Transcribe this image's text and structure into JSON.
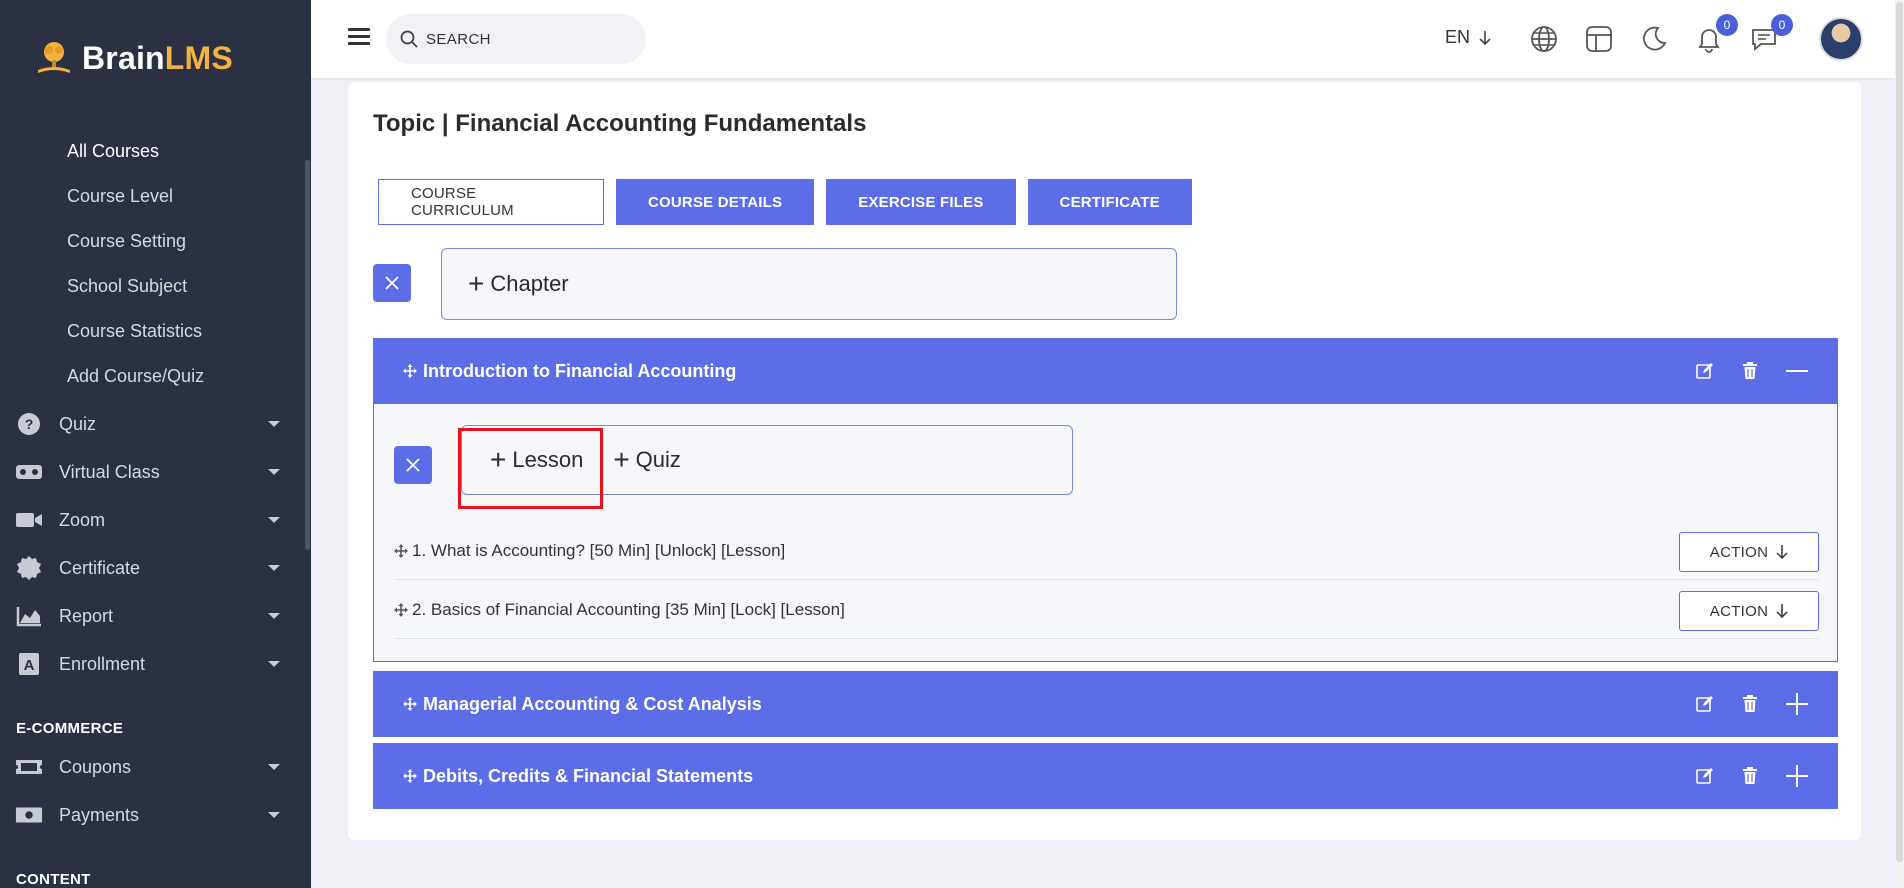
{
  "brand": {
    "name_white": "Brain",
    "name_yellow": "LMS"
  },
  "sidebar": {
    "sub_items": [
      {
        "label": "All Courses",
        "active": true
      },
      {
        "label": "Course Level"
      },
      {
        "label": "Course Setting"
      },
      {
        "label": "School Subject"
      },
      {
        "label": "Course Statistics"
      },
      {
        "label": "Add Course/Quiz"
      }
    ],
    "menu": [
      {
        "label": "Quiz",
        "icon": "question-circle-icon"
      },
      {
        "label": "Virtual Class",
        "icon": "vr-headset-icon"
      },
      {
        "label": "Zoom",
        "icon": "video-camera-icon"
      },
      {
        "label": "Certificate",
        "icon": "certificate-badge-icon"
      },
      {
        "label": "Report",
        "icon": "area-chart-icon"
      },
      {
        "label": "Enrollment",
        "icon": "enrollment-icon"
      }
    ],
    "section_ecommerce": "E-COMMERCE",
    "ecommerce_menu": [
      {
        "label": "Coupons",
        "icon": "ticket-icon"
      },
      {
        "label": "Payments",
        "icon": "money-bill-icon"
      }
    ],
    "section_content": "CONTENT"
  },
  "topbar": {
    "search_placeholder": "SEARCH",
    "lang": "EN",
    "notifications_count": "0",
    "messages_count": "0"
  },
  "main": {
    "title": "Topic | Financial Accounting Fundamentals",
    "tabs": [
      "COURSE CURRICULUM",
      "COURSE DETAILS",
      "EXERCISE FILES",
      "CERTIFICATE"
    ],
    "add_chapter": "Chapter",
    "add_lesson": "Lesson",
    "add_quiz": "Quiz",
    "chapters": [
      {
        "title": "Introduction to Financial Accounting",
        "expanded": true,
        "lessons": [
          {
            "text": "1. What is Accounting? [50 Min] [Unlock] [Lesson]",
            "action": "ACTION"
          },
          {
            "text": "2. Basics of Financial Accounting [35 Min] [Lock] [Lesson]",
            "action": "ACTION"
          }
        ]
      },
      {
        "title": "Managerial Accounting & Cost Analysis",
        "expanded": false
      },
      {
        "title": "Debits, Credits & Financial Statements",
        "expanded": false
      }
    ]
  },
  "colors": {
    "sidebar": "#2b3142",
    "accent": "#5b6ee8",
    "brand_yellow": "#f4b23e",
    "highlight": "#e8111c"
  }
}
